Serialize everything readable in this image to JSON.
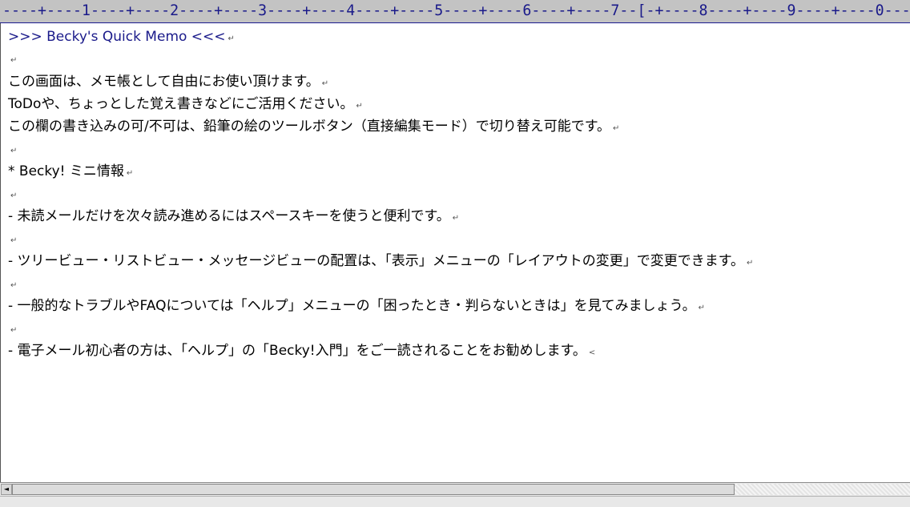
{
  "ruler": {
    "text": "----+----1----+----2----+----3----+----4----+----5----+----6----+----7--[-+----8----+----9----+----0---"
  },
  "memo": {
    "lines": [
      {
        "text": ">>> Becky's Quick Memo <<<",
        "mark": "↵"
      },
      {
        "text": "",
        "mark": "↵"
      },
      {
        "text": "この画面は、メモ帳として自由にお使い頂けます。",
        "mark": "↵"
      },
      {
        "text": "ToDoや、ちょっとした覚え書きなどにご活用ください。",
        "mark": "↵"
      },
      {
        "text": "この欄の書き込みの可/不可は、鉛筆の絵のツールボタン（直接編集モード）で切り替え可能です。",
        "mark": "↵"
      },
      {
        "text": "",
        "mark": "↵"
      },
      {
        "text": "* Becky! ミニ情報",
        "mark": "↵"
      },
      {
        "text": "",
        "mark": "↵"
      },
      {
        "text": "- 未読メールだけを次々読み進めるにはスペースキーを使うと便利です。",
        "mark": "↵"
      },
      {
        "text": "",
        "mark": "↵"
      },
      {
        "text": "- ツリービュー・リストビュー・メッセージビューの配置は、「表示」メニューの「レイアウトの変更」で変更できます。",
        "mark": "↵"
      },
      {
        "text": "",
        "mark": "↵"
      },
      {
        "text": "- 一般的なトラブルやFAQについては「ヘルプ」メニューの「困ったとき・判らないときは」を見てみましょう。",
        "mark": "↵"
      },
      {
        "text": "",
        "mark": "↵"
      },
      {
        "text": "- 電子メール初心者の方は、「ヘルプ」の「Becky!入門」をご一読されることをお勧めします。",
        "mark": "<"
      }
    ]
  },
  "scrollbar": {
    "left_arrow": "◄"
  }
}
